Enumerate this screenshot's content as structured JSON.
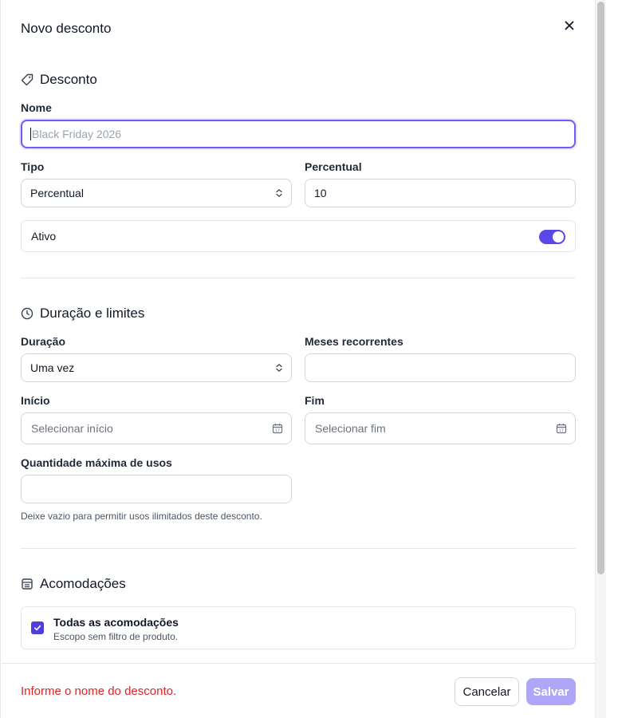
{
  "dialog": {
    "title": "Novo desconto",
    "close_icon": "close-icon"
  },
  "section_discount": {
    "title": "Desconto",
    "icon": "tag-icon",
    "name_label": "Nome",
    "name_value": "",
    "name_placeholder": "Black Friday 2026",
    "type_label": "Tipo",
    "type_value": "Percentual",
    "percent_label": "Percentual",
    "percent_value": "10",
    "active_label": "Ativo",
    "active_on": true
  },
  "section_duration": {
    "title": "Duração e limites",
    "icon": "clock-icon",
    "duration_label": "Duração",
    "duration_value": "Uma vez",
    "recurring_label": "Meses recorrentes",
    "recurring_value": "",
    "start_label": "Início",
    "start_placeholder": "Selecionar início",
    "end_label": "Fim",
    "end_placeholder": "Selecionar fim",
    "max_uses_label": "Quantidade máxima de usos",
    "max_uses_value": "",
    "max_uses_help": "Deixe vazio para permitir usos ilimitados deste desconto."
  },
  "section_rooms": {
    "title": "Acomodações",
    "icon": "building-icon",
    "all_rooms_label": "Todas as acomodações",
    "all_rooms_sub": "Escopo sem filtro de produto.",
    "all_rooms_checked": true
  },
  "footer": {
    "error": "Informe o nome do desconto.",
    "cancel_label": "Cancelar",
    "save_label": "Salvar"
  },
  "colors": {
    "accent": "#5b46e8",
    "accent_disabled": "#b0a6f7",
    "error": "#dc2626"
  }
}
